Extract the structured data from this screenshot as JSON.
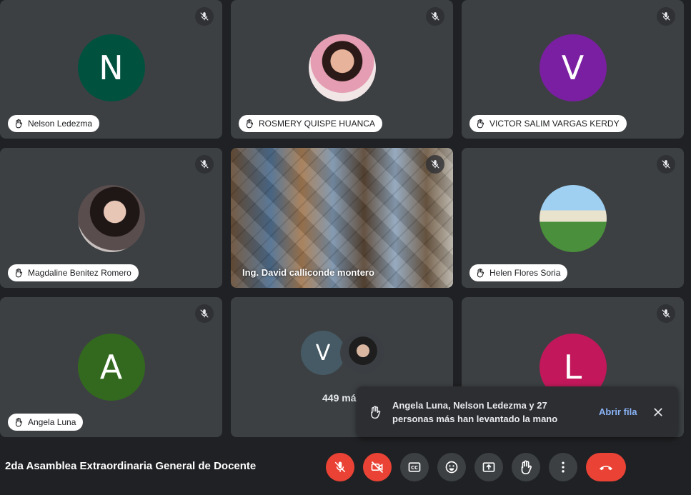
{
  "meeting": {
    "title": "2da Asamblea Extraordinaria General de Docente"
  },
  "participants": [
    {
      "name": "Nelson Ledezma",
      "initial": "N",
      "color": "#01513f"
    },
    {
      "name": "ROSMERY QUISPE HUANCA",
      "photo": "woman-portrait"
    },
    {
      "name": "VICTOR SALIM VARGAS KERDY",
      "initial": "V",
      "color": "#7b1fa2"
    },
    {
      "name": "Magdaline Benitez Romero",
      "photo": "woman-portrait"
    },
    {
      "name": "Ing. David calliconde montero",
      "video": "chevron-wood-background"
    },
    {
      "name": "Helen Flores Soria",
      "photo": "group-beach-photo"
    },
    {
      "name": "Angela Luna",
      "initial": "A",
      "color": "#33691e"
    },
    {
      "group": {
        "initial": "V",
        "color": "#455a64",
        "more_label": "449 más"
      }
    },
    {
      "initial": "L",
      "color": "#c2185b"
    }
  ],
  "toast": {
    "text": "Angela Luna, Nelson Ledezma y 27 personas más han levantado la mano",
    "action": "Abrir fila",
    "icon": "raised-hand-icon"
  },
  "controls": [
    {
      "name": "mic-off-icon",
      "color": "#ea4335"
    },
    {
      "name": "camera-off-icon",
      "color": "#ea4335"
    },
    {
      "name": "captions-icon",
      "color": "#3c4043"
    },
    {
      "name": "emoji-icon",
      "color": "#3c4043"
    },
    {
      "name": "present-screen-icon",
      "color": "#3c4043"
    },
    {
      "name": "raise-hand-icon",
      "color": "#3c4043"
    },
    {
      "name": "more-options-icon",
      "color": "#3c4043"
    },
    {
      "name": "end-call-icon",
      "color": "#ea4335"
    }
  ]
}
